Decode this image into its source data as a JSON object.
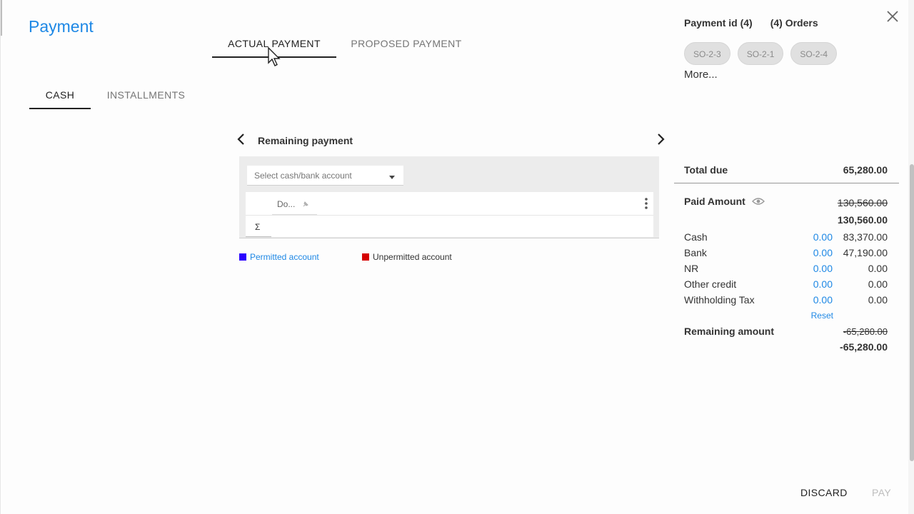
{
  "dialog": {
    "title": "Payment",
    "top_tabs": [
      {
        "label": "ACTUAL PAYMENT",
        "active": true
      },
      {
        "label": "PROPOSED PAYMENT",
        "active": false
      }
    ],
    "sub_tabs": [
      {
        "label": "CASH",
        "active": true
      },
      {
        "label": "INSTALLMENTS",
        "active": false
      }
    ]
  },
  "header_right": {
    "payment_id": "Payment id (4)",
    "orders": "(4) Orders",
    "chips": [
      "SO-2-3",
      "SO-2-1",
      "SO-2-4"
    ],
    "more": "More..."
  },
  "center": {
    "title": "Remaining payment",
    "select_placeholder": "Select cash/bank account",
    "column_header": "Do...",
    "sigma": "Σ",
    "legend": [
      {
        "label": "Permitted account",
        "color": "#2b00ff"
      },
      {
        "label": "Unpermitted account",
        "color": "#d50000"
      }
    ]
  },
  "summary": {
    "total_due_label": "Total due",
    "total_due_value": "65,280.00",
    "paid_label": "Paid Amount",
    "paid_old": "130,560.00",
    "paid_new": "130,560.00",
    "lines": [
      {
        "label": "Cash",
        "input": "0.00",
        "value": "83,370.00"
      },
      {
        "label": "Bank",
        "input": "0.00",
        "value": "47,190.00"
      },
      {
        "label": "NR",
        "input": "0.00",
        "value": "0.00"
      },
      {
        "label": "Other credit",
        "input": "0.00",
        "value": "0.00"
      },
      {
        "label": "Withholding Tax",
        "input": "0.00",
        "value": "0.00"
      }
    ],
    "reset": "Reset",
    "remaining_label": "Remaining amount",
    "remaining_old": "-65,280.00",
    "remaining_new": "-65,280.00"
  },
  "actions": {
    "discard": "DISCARD",
    "pay": "PAY"
  },
  "colors": {
    "accent": "#1e88e5",
    "chip_bg": "#e0e0e0"
  }
}
